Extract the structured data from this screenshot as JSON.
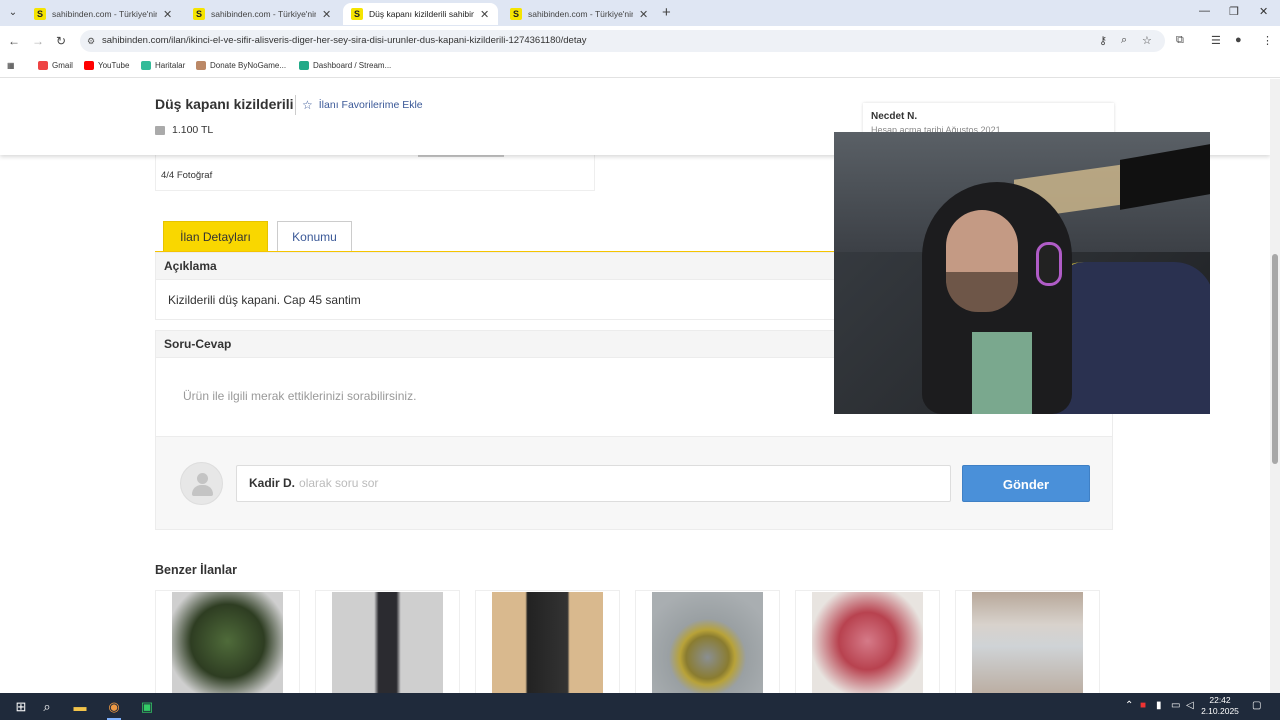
{
  "browser": {
    "tabs": [
      {
        "favicon": "S",
        "title": "sahibinden.com - Türkiye'nin O",
        "active": false
      },
      {
        "favicon": "S",
        "title": "sahibinden.com - Türkiye'nin O",
        "active": false
      },
      {
        "favicon": "S",
        "title": "Düş kapanı kizilderili sahibinde",
        "active": true
      },
      {
        "favicon": "S",
        "title": "sahibinden.com - Türkiye'nin O",
        "active": false
      }
    ],
    "new_tab": "+",
    "url": "sahibinden.com/ilan/ikinci-el-ve-sifir-alisveris-diger-her-sey-sira-disi-urunler-dus-kapani-kizilderili-1274361180/detay",
    "bookmarks": [
      "Gmail",
      "YouTube",
      "Haritalar",
      "Donate ByNoGame...",
      "Dashboard / Stream..."
    ]
  },
  "listing": {
    "title": "Düş kapanı kizilderili",
    "favorite_label": "İlanı Favorilerime Ekle",
    "price": "1.100 TL",
    "photo_count": "4/4 Fotoğraf"
  },
  "seller": {
    "name": "Necdet N.",
    "subtitle": "Hesap açma tarihi Ağustos 2021"
  },
  "detail_tabs": [
    {
      "label": "İlan Detayları",
      "active": true
    },
    {
      "label": "Konumu",
      "active": false
    }
  ],
  "description": {
    "heading": "Açıklama",
    "text": "Kizilderili düş kapani. Cap 45 santim"
  },
  "qa": {
    "heading": "Soru-Cevap",
    "placeholder": "Ürün ile ilgili merak ettiklerinizi sorabilirsiniz.",
    "user": "Kadir D.",
    "input_placeholder": "olarak soru sor",
    "send_label": "Gönder"
  },
  "similar": {
    "heading": "Benzer İlanlar",
    "items": [
      "joker mask",
      "dark sculpture",
      "radio device",
      "alloy wheel",
      "pirate figurine",
      "metal parts"
    ]
  },
  "taskbar": {
    "time": "22:42",
    "date": "2.10.2025"
  },
  "colors": {
    "accent_yellow": "#f9d700",
    "link_blue": "#3b5998",
    "button_blue": "#4a90d9"
  }
}
